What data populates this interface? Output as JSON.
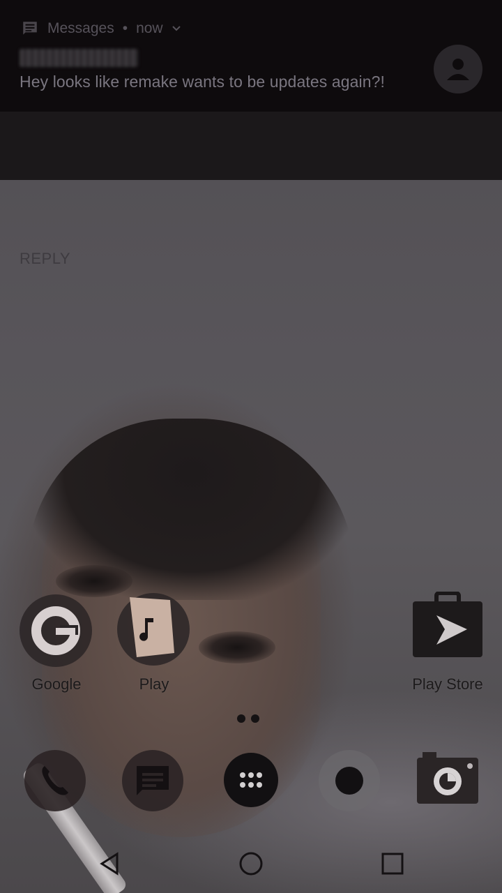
{
  "notification": {
    "app_name": "Messages",
    "time": "now",
    "header_sep": "•",
    "message": "Hey looks like remake wants to be updates again?!",
    "reply_label": "REPLY"
  },
  "home": {
    "apps": [
      {
        "label": "Google"
      },
      {
        "label": "Play"
      },
      {
        "label": "Play Store"
      }
    ],
    "dock": [
      "phone",
      "messages",
      "app-drawer",
      "chrome",
      "camera"
    ]
  },
  "colors": {
    "notif_bg": "#0e0b0d",
    "notif_actions_bg": "#1b181a",
    "label_text": "#1c1a1b"
  }
}
